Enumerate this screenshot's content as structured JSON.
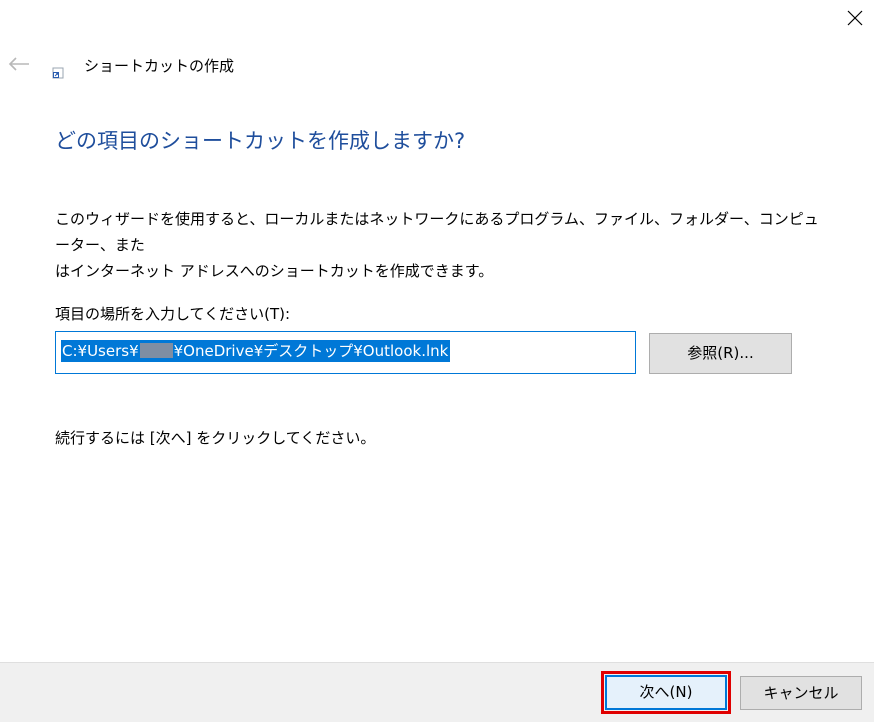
{
  "window": {
    "title": "ショートカットの作成",
    "close_icon": "close-icon",
    "back_icon": "back-arrow-icon",
    "app_icon": "shortcut-icon"
  },
  "main": {
    "heading": "どの項目のショートカットを作成しますか?",
    "description_line1": "このウィザードを使用すると、ローカルまたはネットワークにあるプログラム、ファイル、フォルダー、コンピューター、また",
    "description_line2": "はインターネット アドレスへのショートカットを作成できます。",
    "location_label": "項目の場所を入力してください(T):",
    "location_value_before": "C:¥Users¥",
    "location_value_after": "¥OneDrive¥デスクトップ¥Outlook.lnk",
    "browse_label": "参照(R)...",
    "continue_note": "続行するには [次へ] をクリックしてください。"
  },
  "footer": {
    "next_label": "次へ(N)",
    "cancel_label": "キャンセル"
  },
  "colors": {
    "heading": "#1f4e9c",
    "accent": "#0078d7",
    "highlight": "#e00000",
    "footer_bg": "#f0f0f0"
  }
}
